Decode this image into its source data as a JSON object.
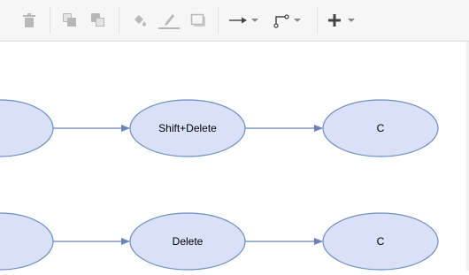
{
  "toolbar": {
    "tools": [
      {
        "name": "delete",
        "icon": "trash-icon",
        "enabled": false
      },
      {
        "name": "to-front",
        "icon": "to-front-icon",
        "enabled": false
      },
      {
        "name": "to-back",
        "icon": "to-back-icon",
        "enabled": false
      },
      {
        "name": "fill-color",
        "icon": "paint-bucket-icon",
        "enabled": false
      },
      {
        "name": "line-color",
        "icon": "pencil-icon",
        "enabled": false
      },
      {
        "name": "shadow",
        "icon": "shadow-box-icon",
        "enabled": false
      },
      {
        "name": "connection",
        "icon": "arrow-right-icon",
        "enabled": true,
        "dropdown": true
      },
      {
        "name": "waypoints",
        "icon": "waypoint-icon",
        "enabled": true,
        "dropdown": true
      },
      {
        "name": "insert",
        "icon": "plus-icon",
        "enabled": true,
        "dropdown": true
      }
    ]
  },
  "diagram": {
    "rows": [
      {
        "nodes": [
          {
            "label": ""
          },
          {
            "label": "Shift+Delete"
          },
          {
            "label": "C"
          }
        ]
      },
      {
        "nodes": [
          {
            "label": ""
          },
          {
            "label": "Delete"
          },
          {
            "label": "C"
          }
        ]
      }
    ]
  },
  "colors": {
    "node_fill": "#dae0f7",
    "node_stroke": "#6c8ebf",
    "edge": "#6c82b6",
    "toolbar_bg": "#f6f6f6",
    "icon_disabled": "#b8b8b8",
    "icon_enabled": "#444444"
  }
}
